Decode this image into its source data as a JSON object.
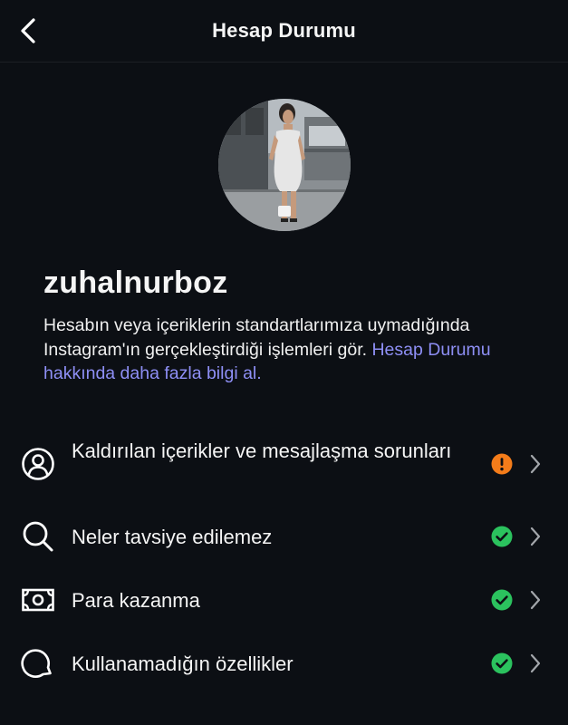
{
  "header": {
    "title": "Hesap Durumu"
  },
  "profile": {
    "username": "zuhalnurboz"
  },
  "description": {
    "text": "Hesabın veya içeriklerin standartlarımıza uymadığında Instagram'ın gerçekleştirdiği işlemleri gör. ",
    "link_text": "Hesap Durumu hakkında daha fazla bilgi al."
  },
  "items": [
    {
      "label": "Kaldırılan içerikler ve mesajlaşma sorunları",
      "icon": "person-circle-icon",
      "status": "warning"
    },
    {
      "label": "Neler tavsiye edilemez",
      "icon": "search-icon",
      "status": "ok"
    },
    {
      "label": "Para kazanma",
      "icon": "money-icon",
      "status": "ok"
    },
    {
      "label": "Kullanamadığın özellikler",
      "icon": "chat-bubble-icon",
      "status": "ok"
    }
  ],
  "colors": {
    "background": "#0c0f14",
    "link": "#8e8ff5",
    "warning": "#f47c1a",
    "ok": "#2bc25e"
  }
}
